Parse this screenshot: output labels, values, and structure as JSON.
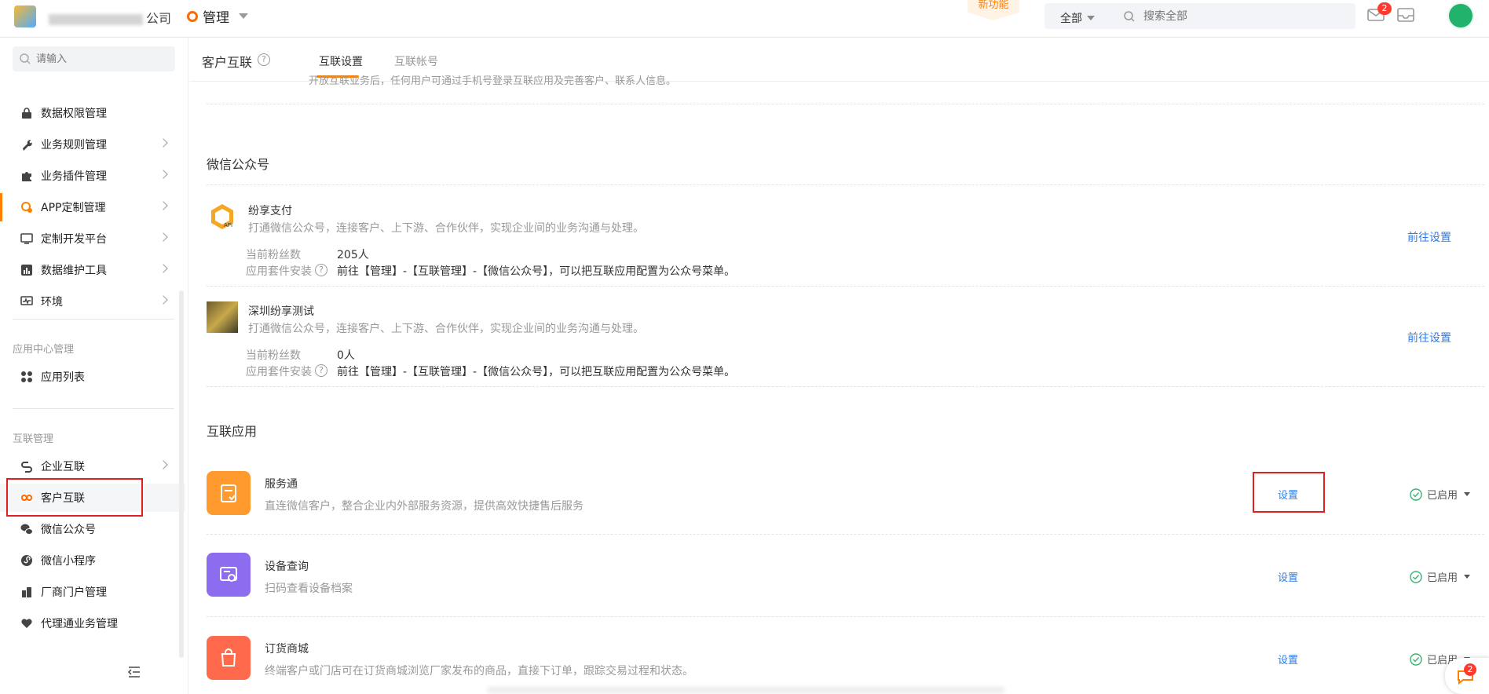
{
  "topbar": {
    "company_suffix": "公司",
    "app_name": "管理",
    "new_feature": "新功能",
    "scope": "全部",
    "search_placeholder": "搜索全部",
    "mail_badge": "2"
  },
  "sidebar": {
    "search_placeholder": "请输入",
    "items": [
      {
        "label": "数据权限管理"
      },
      {
        "label": "业务规则管理"
      },
      {
        "label": "业务插件管理"
      },
      {
        "label": "APP定制管理"
      },
      {
        "label": "定制开发平台"
      },
      {
        "label": "数据维护工具"
      },
      {
        "label": "环境"
      }
    ],
    "section_app": "应用中心管理",
    "app_items": [
      {
        "label": "应用列表"
      }
    ],
    "section_interconnect": "互联管理",
    "inter_items": [
      {
        "label": "企业互联"
      },
      {
        "label": "客户互联"
      },
      {
        "label": "微信公众号"
      },
      {
        "label": "微信小程序"
      },
      {
        "label": "厂商门户管理"
      },
      {
        "label": "代理通业务管理"
      }
    ]
  },
  "page": {
    "title": "客户互联",
    "tabs": [
      {
        "label": "互联设置"
      },
      {
        "label": "互联帐号"
      }
    ],
    "cut_text": "开放互联业务后，任何用户可通过手机号登录互联应用及完善客户、联系人信息。"
  },
  "wechat": {
    "heading": "微信公众号",
    "accounts": [
      {
        "name": "纷享支付",
        "desc": "打通微信公众号，连接客户、上下游、合作伙伴，实现企业间的业务沟通与处理。",
        "fans_label": "当前粉丝数",
        "fans_value": "205人",
        "suite_label": "应用套件安装",
        "suite_value": "前往【管理】-【互联管理】-【微信公众号】，可以把互联应用配置为公众号菜单。",
        "action": "前往设置"
      },
      {
        "name": "深圳纷享测试",
        "desc": "打通微信公众号，连接客户、上下游、合作伙伴，实现企业间的业务沟通与处理。",
        "fans_label": "当前粉丝数",
        "fans_value": "0人",
        "suite_label": "应用套件安装",
        "suite_value": "前往【管理】-【互联管理】-【微信公众号】，可以把互联应用配置为公众号菜单。",
        "action": "前往设置"
      }
    ]
  },
  "apps": {
    "heading": "互联应用",
    "items": [
      {
        "name": "服务通",
        "desc": "直连微信客户，整合企业内外部服务资源，提供高效快捷售后服务",
        "action": "设置",
        "status": "已启用",
        "color": "#ff9a2e"
      },
      {
        "name": "设备查询",
        "desc": "扫码查看设备档案",
        "action": "设置",
        "status": "已启用",
        "color": "#8e6cf0"
      },
      {
        "name": "订货商城",
        "desc": "终端客户或门店可在订货商城浏览厂家发布的商品，直接下订单，跟踪交易过程和状态。",
        "action": "设置",
        "status": "已启用",
        "color": "#ff6a4d"
      }
    ]
  },
  "chat": {
    "badge": "2"
  }
}
